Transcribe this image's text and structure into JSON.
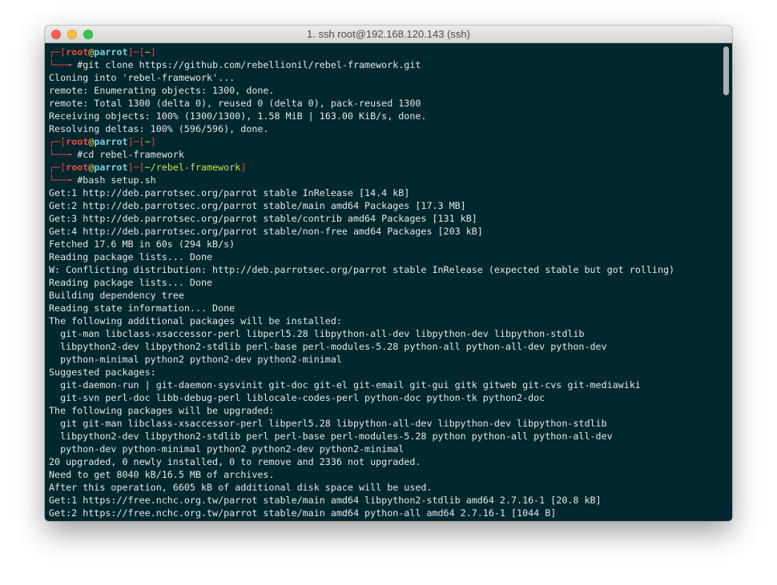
{
  "window": {
    "title": "1. ssh root@192.168.120.143 (ssh)"
  },
  "colors": {
    "background": "#01282f",
    "text": "#e6e6e6",
    "prompt_frame": "#e0463d",
    "user": "#f24a3a",
    "host": "#7ed0e0",
    "path": "#cde04a"
  },
  "terminal": {
    "prompt": {
      "frame_top_open": "┌─[",
      "frame_bottom": "└──╼ ",
      "user": "root",
      "at": "@",
      "host": "parrot",
      "sep": "]─[",
      "close": "]"
    },
    "prompts": [
      {
        "path": "~",
        "command": "#git clone https://github.com/rebellionil/rebel-framework.git"
      },
      {
        "path": "~",
        "command": "#cd rebel-framework"
      },
      {
        "path": "~/rebel-framework",
        "command": "#bash setup.sh"
      }
    ],
    "outputs": [
      [
        "Cloning into 'rebel-framework'...",
        "remote: Enumerating objects: 1300, done.",
        "remote: Total 1300 (delta 0), reused 0 (delta 0), pack-reused 1300",
        "Receiving objects: 100% (1300/1300), 1.58 MiB | 163.00 KiB/s, done.",
        "Resolving deltas: 100% (596/596), done."
      ],
      [],
      [
        "Get:1 http://deb.parrotsec.org/parrot stable InRelease [14.4 kB]",
        "Get:2 http://deb.parrotsec.org/parrot stable/main amd64 Packages [17.3 MB]",
        "Get:3 http://deb.parrotsec.org/parrot stable/contrib amd64 Packages [131 kB]",
        "Get:4 http://deb.parrotsec.org/parrot stable/non-free amd64 Packages [203 kB]",
        "Fetched 17.6 MB in 60s (294 kB/s)",
        "Reading package lists... Done",
        "W: Conflicting distribution: http://deb.parrotsec.org/parrot stable InRelease (expected stable but got rolling)",
        "Reading package lists... Done",
        "Building dependency tree",
        "Reading state information... Done",
        "The following additional packages will be installed:",
        "  git-man libclass-xsaccessor-perl libperl5.28 libpython-all-dev libpython-dev libpython-stdlib",
        "  libpython2-dev libpython2-stdlib perl-base perl-modules-5.28 python-all python-all-dev python-dev",
        "  python-minimal python2 python2-dev python2-minimal",
        "Suggested packages:",
        "  git-daemon-run | git-daemon-sysvinit git-doc git-el git-email git-gui gitk gitweb git-cvs git-mediawiki",
        "  git-svn perl-doc libb-debug-perl liblocale-codes-perl python-doc python-tk python2-doc",
        "The following packages will be upgraded:",
        "  git git-man libclass-xsaccessor-perl libperl5.28 libpython-all-dev libpython-dev libpython-stdlib",
        "  libpython2-dev libpython2-stdlib perl perl-base perl-modules-5.28 python python-all python-all-dev",
        "  python-dev python-minimal python2 python2-dev python2-minimal",
        "20 upgraded, 0 newly installed, 0 to remove and 2336 not upgraded.",
        "Need to get 8040 kB/16.5 MB of archives.",
        "After this operation, 6605 kB of additional disk space will be used.",
        "Get:1 https://free.nchc.org.tw/parrot stable/main amd64 libpython2-stdlib amd64 2.7.16-1 [20.8 kB]",
        "Get:2 https://free.nchc.org.tw/parrot stable/main amd64 python-all amd64 2.7.16-1 [1044 B]"
      ]
    ]
  }
}
